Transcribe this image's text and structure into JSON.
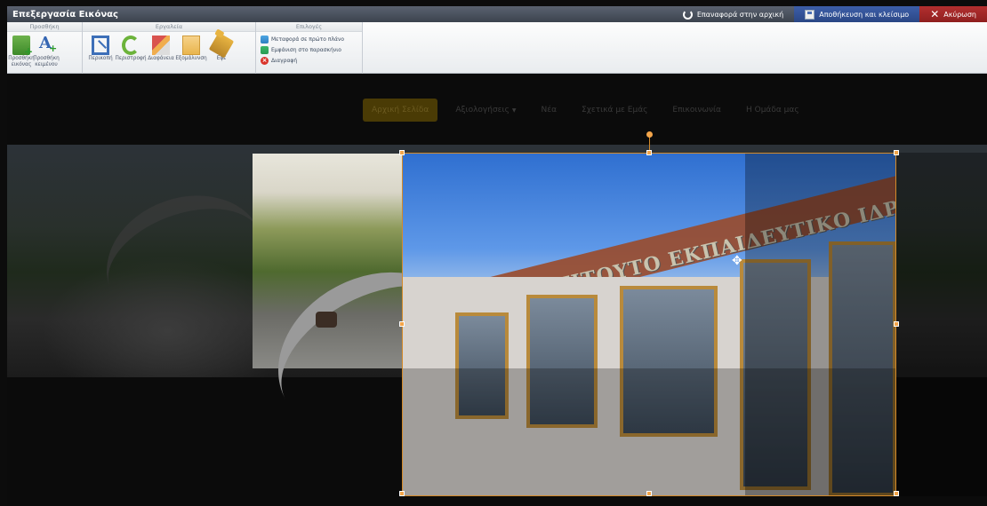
{
  "window": {
    "title": "Επεξεργασία Εικόνας",
    "restore_label": "Επαναφορά στην αρχική",
    "save_label": "Αποθήκευση και κλείσιμο",
    "cancel_label": "Ακύρωση"
  },
  "ribbon": {
    "groups": [
      {
        "title": "Προσθήκη",
        "buttons": [
          {
            "label": "Προσθήκη εικόνας",
            "icon": "add-image-icon"
          },
          {
            "label": "Προσθήκη κειμένου",
            "icon": "add-text-icon"
          }
        ]
      },
      {
        "title": "Εργαλεία",
        "buttons": [
          {
            "label": "Περικοπή",
            "icon": "crop-icon"
          },
          {
            "label": "Περιστροφή",
            "icon": "rotate-icon"
          },
          {
            "label": "Διαφάνεια",
            "icon": "transparency-icon"
          },
          {
            "label": "Εξομάλυνση",
            "icon": "smooth-icon"
          },
          {
            "label": "Εφέ",
            "icon": "effects-icon"
          }
        ]
      },
      {
        "title": "Επιλογές",
        "options": [
          {
            "label": "Μεταφορά σε πρώτο πλάνο",
            "icon": "bring-front-icon"
          },
          {
            "label": "Εμφάνιση στο παρασκήνιο",
            "icon": "send-back-icon"
          },
          {
            "label": "Διαγραφή",
            "icon": "delete-icon"
          }
        ]
      }
    ]
  },
  "canvas": {
    "nav": [
      {
        "label": "Αρχική Σελίδα",
        "active": true
      },
      {
        "label": "Αξιολογήσεις",
        "dropdown": true
      },
      {
        "label": "Νέα"
      },
      {
        "label": "Σχετικά με Εμάς"
      },
      {
        "label": "Επικοινωνία"
      },
      {
        "label": "Η Ομάδα μας"
      }
    ],
    "sign_text": "ΙΝΣΤΙΤΟΥΤΟ ΕΚΠΑΙΔΕΥΤΙΚΟ ΙΔΡΥΜΑ",
    "caption": ""
  },
  "colors": {
    "accent": "#f3a54a",
    "save_bg": "#2a4785",
    "cancel_bg": "#8f1f1f"
  }
}
